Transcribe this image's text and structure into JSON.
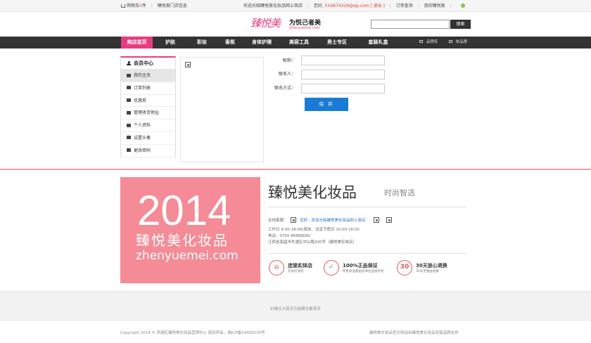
{
  "topbar": {
    "cart": "购物车",
    "cart_count": "0",
    "cart_unit": "件",
    "store_info": "臻悦美门店信息",
    "welcome": "欢迎光临臻悦美化妆品网上商店",
    "greeting": "您好,",
    "email": "516874329@qq.com",
    "logout": "[ 退出 ]",
    "order_query": "订单查询",
    "my_account": "我的臻悦美"
  },
  "header": {
    "logo_script": "臻悦美",
    "slogan": "为悦己者美",
    "domain": "Zhenyuemei.com",
    "search_button": "搜索"
  },
  "nav": {
    "items": [
      "商店首页",
      "护肤",
      "彩妆",
      "香氛",
      "身体护理",
      "美容工具",
      "男士专区",
      "套装礼盒"
    ],
    "active_index": 0,
    "right_links": [
      "品牌库",
      "体品牌"
    ]
  },
  "sidebar": {
    "title": "会员中心",
    "items": [
      "我的主页",
      "订单列表",
      "优惠券",
      "管理收货地址",
      "个人资料",
      "设置头像",
      "更改密码"
    ],
    "active_index": 0
  },
  "form": {
    "nickname_label": "昵称：",
    "contact_label": "联系人：",
    "contact_method_label": "联系方式：",
    "save_button": "保 存"
  },
  "promo": {
    "year": "2014",
    "cn_name": "臻悦美化妆品",
    "en_domain": "zhenyuemei.com"
  },
  "brand": {
    "title": "臻悦美化妆品",
    "subtitle": "时尚智选",
    "online_service_label": "在线客服：",
    "service_greeting": "您好，欢迎光临臻悦美化妆品网上商店",
    "hours": "工作日 9:00-18:00(周末、法定节假日 10:00-16:00",
    "phone": "电话：0791-86888082",
    "address": "江西省南昌市东湖区中山路300号（臻悦美实体店）"
  },
  "features": [
    {
      "icon": "store-icon",
      "glyph": "⌂",
      "title": "连锁实体店",
      "subtitle": "实体店体验"
    },
    {
      "icon": "shield-icon",
      "glyph": "✓",
      "title": "100%正品保证",
      "subtitle": "所售商品都由实体店品质护航"
    },
    {
      "icon": "return-30-icon",
      "glyph": "30",
      "title": "30天放心退换",
      "subtitle": "30天无理由退换"
    }
  ],
  "footer": {
    "note": "价格以人民币为结算交易货币",
    "copyright": "Copyright 2014 © 西湖区臻悦美化妆品营销中心  版权所有，赣ICP备14003230号",
    "support": "臻悦美化妆品官方网站由臻悦美化妆品连锁品牌支持"
  },
  "colors": {
    "accent": "#e63d80",
    "nav": "#333333",
    "button": "#1a7bd6",
    "promo": "#f48b96"
  }
}
